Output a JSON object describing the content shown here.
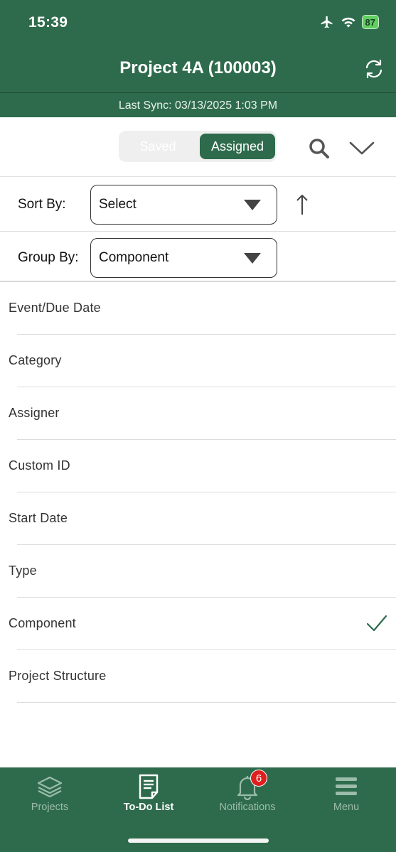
{
  "status_bar": {
    "time": "15:39",
    "battery": "87"
  },
  "header": {
    "title": "Project 4A (100003)",
    "last_sync": "Last Sync: 03/13/2025 1:03 PM"
  },
  "segment": {
    "saved_label": "Saved",
    "assigned_label": "Assigned",
    "selected": "Assigned"
  },
  "sort": {
    "label": "Sort By:",
    "value": "Select"
  },
  "group": {
    "label": "Group By:",
    "value": "Component"
  },
  "options": [
    {
      "label": "Event/Due Date"
    },
    {
      "label": "Category"
    },
    {
      "label": "Assigner"
    },
    {
      "label": "Custom ID"
    },
    {
      "label": "Start Date"
    },
    {
      "label": "Type"
    },
    {
      "label": "Component",
      "selected": true
    },
    {
      "label": "Project Structure"
    }
  ],
  "tabbar": {
    "projects": "Projects",
    "todo": "To-Do List",
    "notifications": "Notifications",
    "notifications_badge": "6",
    "menu": "Menu",
    "active": "To-Do List"
  },
  "colors": {
    "brand": "#2e6b4c",
    "badge": "#e01e1e",
    "check": "#2e6b4c"
  },
  "icons": [
    "airplane-icon",
    "wifi-icon",
    "battery-icon",
    "refresh-icon",
    "search-icon",
    "chevron-down-icon",
    "sort-ascending-arrow-icon",
    "checkmark-icon",
    "layers-icon",
    "document-icon",
    "bell-icon",
    "hamburger-menu-icon"
  ]
}
